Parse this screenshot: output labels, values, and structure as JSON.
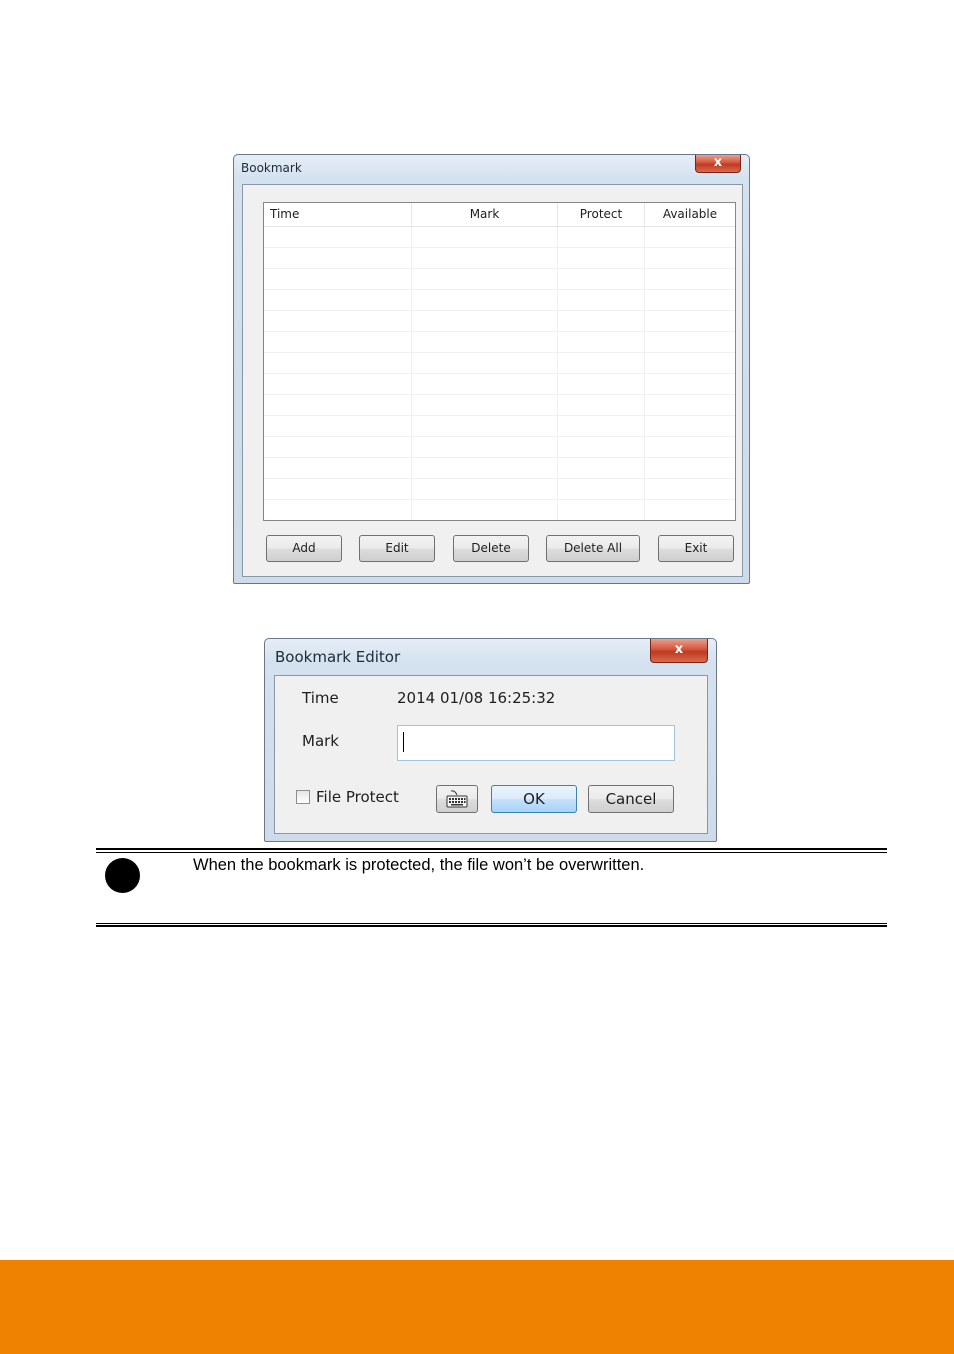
{
  "bookmark_window": {
    "title": "Bookmark",
    "close_glyph": "x",
    "columns": [
      "Time",
      "Mark",
      "Protect",
      "Available"
    ],
    "row_count": 14,
    "buttons": {
      "add": "Add",
      "edit": "Edit",
      "delete": "Delete",
      "delete_all": "Delete All",
      "exit": "Exit"
    }
  },
  "editor_window": {
    "title": "Bookmark Editor",
    "close_glyph": "x",
    "time_label": "Time",
    "time_value": "2014 01/08 16:25:32",
    "mark_label": "Mark",
    "mark_value": "",
    "file_protect_label": "File Protect",
    "file_protect_checked": false,
    "keyboard_icon": "keyboard-icon",
    "ok_label": "OK",
    "cancel_label": "Cancel"
  },
  "note": {
    "icon": "note-dot-icon",
    "text": "When the bookmark is protected, the file won’t be overwritten."
  },
  "colors": {
    "footer": "#ef8200",
    "close_button": "#c8442a",
    "window_frame": "#cddbea"
  }
}
